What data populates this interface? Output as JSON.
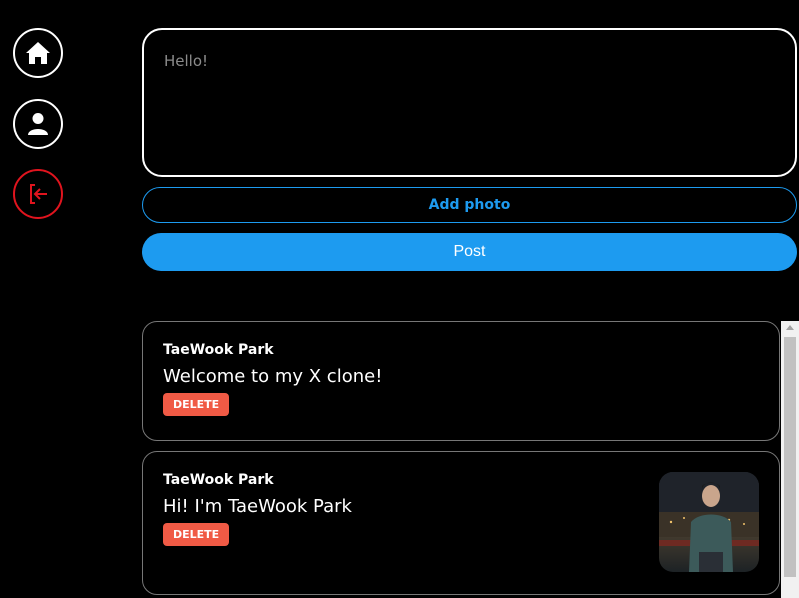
{
  "nav": {
    "home_icon": "home-icon",
    "profile_icon": "user-icon",
    "logout_icon": "logout-icon",
    "logout_color": "#e0141e"
  },
  "compose": {
    "placeholder": "Hello!",
    "add_photo_label": "Add photo",
    "post_label": "Post",
    "accent_color": "#1d9bf0"
  },
  "tweets": [
    {
      "author": "TaeWook Park",
      "text": "Welcome to my X clone!",
      "delete_label": "DELETE"
    },
    {
      "author": "TaeWook Park",
      "text": "Hi! I'm TaeWook Park",
      "delete_label": "DELETE",
      "has_photo": true
    }
  ]
}
